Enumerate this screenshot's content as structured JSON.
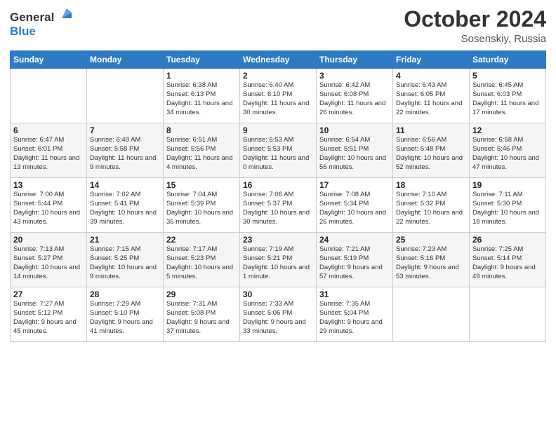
{
  "header": {
    "logo": {
      "general": "General",
      "blue": "Blue"
    },
    "title": "October 2024",
    "location": "Sosenskiy, Russia"
  },
  "weekdays": [
    "Sunday",
    "Monday",
    "Tuesday",
    "Wednesday",
    "Thursday",
    "Friday",
    "Saturday"
  ],
  "weeks": [
    [
      {
        "day": "",
        "sunrise": "",
        "sunset": "",
        "daylight": ""
      },
      {
        "day": "",
        "sunrise": "",
        "sunset": "",
        "daylight": ""
      },
      {
        "day": "1",
        "sunrise": "Sunrise: 6:38 AM",
        "sunset": "Sunset: 6:13 PM",
        "daylight": "Daylight: 11 hours and 34 minutes."
      },
      {
        "day": "2",
        "sunrise": "Sunrise: 6:40 AM",
        "sunset": "Sunset: 6:10 PM",
        "daylight": "Daylight: 11 hours and 30 minutes."
      },
      {
        "day": "3",
        "sunrise": "Sunrise: 6:42 AM",
        "sunset": "Sunset: 6:08 PM",
        "daylight": "Daylight: 11 hours and 26 minutes."
      },
      {
        "day": "4",
        "sunrise": "Sunrise: 6:43 AM",
        "sunset": "Sunset: 6:05 PM",
        "daylight": "Daylight: 11 hours and 22 minutes."
      },
      {
        "day": "5",
        "sunrise": "Sunrise: 6:45 AM",
        "sunset": "Sunset: 6:03 PM",
        "daylight": "Daylight: 11 hours and 17 minutes."
      }
    ],
    [
      {
        "day": "6",
        "sunrise": "Sunrise: 6:47 AM",
        "sunset": "Sunset: 6:01 PM",
        "daylight": "Daylight: 11 hours and 13 minutes."
      },
      {
        "day": "7",
        "sunrise": "Sunrise: 6:49 AM",
        "sunset": "Sunset: 5:58 PM",
        "daylight": "Daylight: 11 hours and 9 minutes."
      },
      {
        "day": "8",
        "sunrise": "Sunrise: 6:51 AM",
        "sunset": "Sunset: 5:56 PM",
        "daylight": "Daylight: 11 hours and 4 minutes."
      },
      {
        "day": "9",
        "sunrise": "Sunrise: 6:53 AM",
        "sunset": "Sunset: 5:53 PM",
        "daylight": "Daylight: 11 hours and 0 minutes."
      },
      {
        "day": "10",
        "sunrise": "Sunrise: 6:54 AM",
        "sunset": "Sunset: 5:51 PM",
        "daylight": "Daylight: 10 hours and 56 minutes."
      },
      {
        "day": "11",
        "sunrise": "Sunrise: 6:56 AM",
        "sunset": "Sunset: 5:48 PM",
        "daylight": "Daylight: 10 hours and 52 minutes."
      },
      {
        "day": "12",
        "sunrise": "Sunrise: 6:58 AM",
        "sunset": "Sunset: 5:46 PM",
        "daylight": "Daylight: 10 hours and 47 minutes."
      }
    ],
    [
      {
        "day": "13",
        "sunrise": "Sunrise: 7:00 AM",
        "sunset": "Sunset: 5:44 PM",
        "daylight": "Daylight: 10 hours and 43 minutes."
      },
      {
        "day": "14",
        "sunrise": "Sunrise: 7:02 AM",
        "sunset": "Sunset: 5:41 PM",
        "daylight": "Daylight: 10 hours and 39 minutes."
      },
      {
        "day": "15",
        "sunrise": "Sunrise: 7:04 AM",
        "sunset": "Sunset: 5:39 PM",
        "daylight": "Daylight: 10 hours and 35 minutes."
      },
      {
        "day": "16",
        "sunrise": "Sunrise: 7:06 AM",
        "sunset": "Sunset: 5:37 PM",
        "daylight": "Daylight: 10 hours and 30 minutes."
      },
      {
        "day": "17",
        "sunrise": "Sunrise: 7:08 AM",
        "sunset": "Sunset: 5:34 PM",
        "daylight": "Daylight: 10 hours and 26 minutes."
      },
      {
        "day": "18",
        "sunrise": "Sunrise: 7:10 AM",
        "sunset": "Sunset: 5:32 PM",
        "daylight": "Daylight: 10 hours and 22 minutes."
      },
      {
        "day": "19",
        "sunrise": "Sunrise: 7:11 AM",
        "sunset": "Sunset: 5:30 PM",
        "daylight": "Daylight: 10 hours and 18 minutes."
      }
    ],
    [
      {
        "day": "20",
        "sunrise": "Sunrise: 7:13 AM",
        "sunset": "Sunset: 5:27 PM",
        "daylight": "Daylight: 10 hours and 14 minutes."
      },
      {
        "day": "21",
        "sunrise": "Sunrise: 7:15 AM",
        "sunset": "Sunset: 5:25 PM",
        "daylight": "Daylight: 10 hours and 9 minutes."
      },
      {
        "day": "22",
        "sunrise": "Sunrise: 7:17 AM",
        "sunset": "Sunset: 5:23 PM",
        "daylight": "Daylight: 10 hours and 5 minutes."
      },
      {
        "day": "23",
        "sunrise": "Sunrise: 7:19 AM",
        "sunset": "Sunset: 5:21 PM",
        "daylight": "Daylight: 10 hours and 1 minute."
      },
      {
        "day": "24",
        "sunrise": "Sunrise: 7:21 AM",
        "sunset": "Sunset: 5:19 PM",
        "daylight": "Daylight: 9 hours and 57 minutes."
      },
      {
        "day": "25",
        "sunrise": "Sunrise: 7:23 AM",
        "sunset": "Sunset: 5:16 PM",
        "daylight": "Daylight: 9 hours and 53 minutes."
      },
      {
        "day": "26",
        "sunrise": "Sunrise: 7:25 AM",
        "sunset": "Sunset: 5:14 PM",
        "daylight": "Daylight: 9 hours and 49 minutes."
      }
    ],
    [
      {
        "day": "27",
        "sunrise": "Sunrise: 7:27 AM",
        "sunset": "Sunset: 5:12 PM",
        "daylight": "Daylight: 9 hours and 45 minutes."
      },
      {
        "day": "28",
        "sunrise": "Sunrise: 7:29 AM",
        "sunset": "Sunset: 5:10 PM",
        "daylight": "Daylight: 9 hours and 41 minutes."
      },
      {
        "day": "29",
        "sunrise": "Sunrise: 7:31 AM",
        "sunset": "Sunset: 5:08 PM",
        "daylight": "Daylight: 9 hours and 37 minutes."
      },
      {
        "day": "30",
        "sunrise": "Sunrise: 7:33 AM",
        "sunset": "Sunset: 5:06 PM",
        "daylight": "Daylight: 9 hours and 33 minutes."
      },
      {
        "day": "31",
        "sunrise": "Sunrise: 7:35 AM",
        "sunset": "Sunset: 5:04 PM",
        "daylight": "Daylight: 9 hours and 29 minutes."
      },
      {
        "day": "",
        "sunrise": "",
        "sunset": "",
        "daylight": ""
      },
      {
        "day": "",
        "sunrise": "",
        "sunset": "",
        "daylight": ""
      }
    ]
  ]
}
